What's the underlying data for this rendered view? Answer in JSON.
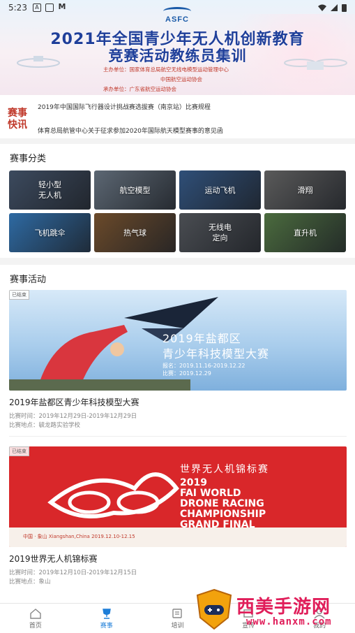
{
  "status_bar": {
    "time": "5:23"
  },
  "banner": {
    "logo_text": "ASFC",
    "title_line1": "2021年全国青少年无人机创新教育",
    "title_line2": "竞赛活动教练员集训",
    "org_line1": "主办单位：国家体育总局航空无线电模型运动管理中心",
    "org_line2": "中国航空运动协会",
    "org_line3": "承办单位：广东省航空运动协会"
  },
  "news": {
    "tag": "赛事快讯",
    "items": [
      "2019年中国国际飞行器设计挑战赛选拔赛（南京站）比赛规程",
      "体育总局航管中心关于征求参加2020年国际航天模型赛事的意见函"
    ]
  },
  "categories": {
    "title": "赛事分类",
    "items": [
      {
        "label": "轻小型\n无人机",
        "color": "#3c4a5e"
      },
      {
        "label": "航空模型",
        "color": "#5c6773"
      },
      {
        "label": "运动飞机",
        "color": "#2f4f78"
      },
      {
        "label": "滑翔",
        "color": "#5a5a5a"
      },
      {
        "label": "飞机跳伞",
        "color": "#2e6aa3"
      },
      {
        "label": "热气球",
        "color": "#6b4a2a"
      },
      {
        "label": "无线电\n定向",
        "color": "#4a4d52"
      },
      {
        "label": "直升机",
        "color": "#4b6b3e"
      }
    ]
  },
  "activities": {
    "title": "赛事活动",
    "items": [
      {
        "badge": "已结束",
        "name": "2019年盐都区青少年科技模型大赛",
        "time": "比赛时间：2019年12月29日-2019年12月29日",
        "place": "比赛地点：毓龙路实验学校",
        "poster_line1": "2019年盐都区",
        "poster_line2": "青少年科技模型大赛",
        "poster_line3": "报名：2019.11.16-2019.12.22",
        "poster_line4": "比赛：2019.12.29"
      },
      {
        "badge": "已结束",
        "name": "2019世界无人机锦标赛",
        "time": "比赛时间：2019年12月10日-2019年12月15日",
        "place": "比赛地点：象山",
        "poster_cn": "世界无人机锦标赛",
        "poster_en1": "2019",
        "poster_en2": "FAI WORLD",
        "poster_en3": "DRONE RACING",
        "poster_en4": "CHAMPIONSHIP",
        "poster_en5": "GRAND FINAL",
        "poster_loc": "中国 · 象山  Xiangshan,China  2019.12.10-12.15"
      }
    ]
  },
  "tabbar": {
    "items": [
      {
        "label": "首页",
        "icon": "home-icon"
      },
      {
        "label": "赛事",
        "icon": "trophy-icon",
        "active": true
      },
      {
        "label": "培训",
        "icon": "training-icon"
      },
      {
        "label": "宣传",
        "icon": "news-icon"
      },
      {
        "label": "我的",
        "icon": "user-icon"
      }
    ]
  },
  "watermark": {
    "title": "西美手游网",
    "url": "www.hanxm.com"
  }
}
